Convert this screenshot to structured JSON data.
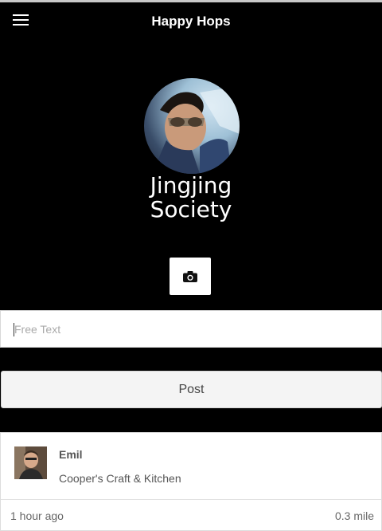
{
  "header": {
    "title": "Happy Hops",
    "menu_icon": "hamburger-menu-icon"
  },
  "profile": {
    "name_line1": "Jingjing",
    "name_line2": "Society",
    "camera_icon": "camera-icon"
  },
  "composer": {
    "placeholder": "Free Text",
    "value": "",
    "post_label": "Post"
  },
  "feed": {
    "items": [
      {
        "user": "Emil",
        "venue": "Cooper's Craft & Kitchen",
        "time_ago": "1 hour ago",
        "distance": "0.3 mile"
      }
    ]
  }
}
